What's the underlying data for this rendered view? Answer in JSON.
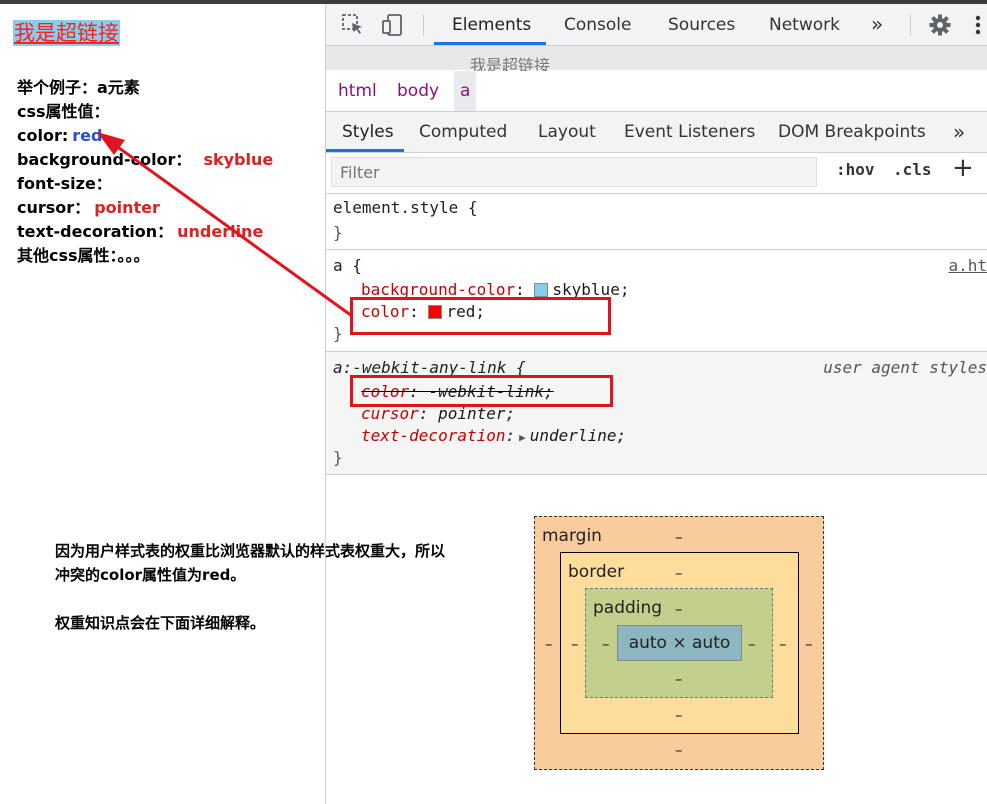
{
  "page": {
    "link_text": "我是超链接",
    "lines": [
      {
        "label": "举个例子：a元素",
        "value": ""
      },
      {
        "label": "css属性值：",
        "value": ""
      },
      {
        "label": "color:",
        "value": "red"
      },
      {
        "label": "background-color：",
        "value": "skyblue"
      },
      {
        "label": "font-size：",
        "value": ""
      },
      {
        "label": "cursor：",
        "value": "pointer"
      },
      {
        "label": "text-decoration：",
        "value": "underline"
      },
      {
        "label": "其他css属性：。。。",
        "value": ""
      }
    ],
    "note_lines": [
      "因为用户样式表的权重比浏览器默认的样式表权重大，所以",
      "冲突的color属性值为red。",
      "",
      "权重知识点会在下面详细解释。"
    ]
  },
  "devtools": {
    "tabs": [
      "Elements",
      "Console",
      "Sources",
      "Network"
    ],
    "more": "»",
    "preview": "我是超链接",
    "breadcrumbs": [
      "html",
      "body",
      "a"
    ],
    "subtabs": [
      "Styles",
      "Computed",
      "Layout",
      "Event Listeners",
      "DOM Breakpoints"
    ],
    "filter_placeholder": "Filter",
    "hov": ":hov",
    "cls": ".cls",
    "plus": "+",
    "rules": {
      "element_style": {
        "selector": "element.style {",
        "close": "}"
      },
      "author": {
        "selector": "a {",
        "source": "a.ht",
        "props": [
          {
            "name": "background-color",
            "value": "skyblue",
            "swatch": "#87ceeb"
          },
          {
            "name": "color",
            "value": "red",
            "swatch": "#ff0000"
          }
        ],
        "close": "}"
      },
      "ua": {
        "selector": "a:-webkit-any-link {",
        "source": "user agent styles",
        "props": [
          {
            "name": "color",
            "value": "-webkit-link;",
            "struck": true
          },
          {
            "name": "cursor",
            "value": "pointer;"
          },
          {
            "name": "text-decoration",
            "value": "underline;"
          }
        ],
        "close": "}"
      }
    },
    "box_model": {
      "margin": "margin",
      "border": "border",
      "padding": "padding",
      "content": "auto × auto",
      "dash": "–"
    }
  },
  "colors": {
    "annotation_red": "#e0141e",
    "link_bg": "#87ceeb",
    "accent": "#1a73e8"
  }
}
